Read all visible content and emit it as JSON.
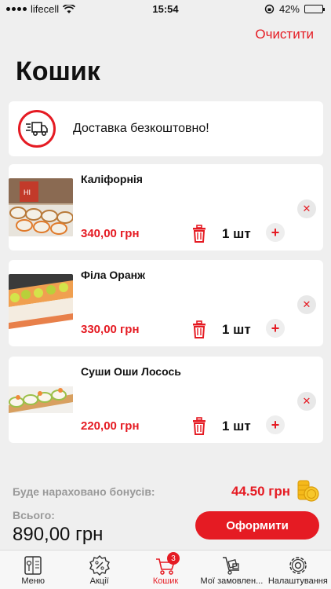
{
  "status": {
    "carrier": "lifecell",
    "time": "15:54",
    "battery": "42%",
    "battery_level": 0.42
  },
  "header": {
    "clear_label": "Очистити",
    "title": "Кошик"
  },
  "delivery": {
    "text": "Доставка безкоштовно!",
    "icon": "truck-icon"
  },
  "items": [
    {
      "name": "Каліфорнія",
      "price": "340,00 грн",
      "qty": "1 шт"
    },
    {
      "name": "Філа Оранж",
      "price": "330,00 грн",
      "qty": "1 шт"
    },
    {
      "name": "Суши Оши Лосось",
      "price": "220,00 грн",
      "qty": "1 шт"
    }
  ],
  "summary": {
    "bonus_label": "Буде нараховано бонусів:",
    "bonus_value": "44.50 грн",
    "total_label": "Всього:",
    "total_value": "890,00 грн",
    "checkout_label": "Оформити"
  },
  "tabs": [
    {
      "label": "Меню",
      "icon": "menu-book-icon"
    },
    {
      "label": "Акції",
      "icon": "discount-icon"
    },
    {
      "label": "Кошик",
      "icon": "cart-icon",
      "badge": "3",
      "active": true
    },
    {
      "label": "Мої замовлен...",
      "icon": "orders-icon"
    },
    {
      "label": "Налаштування",
      "icon": "settings-gear-icon"
    }
  ],
  "colors": {
    "accent": "#e51b23",
    "background": "#efefef"
  }
}
